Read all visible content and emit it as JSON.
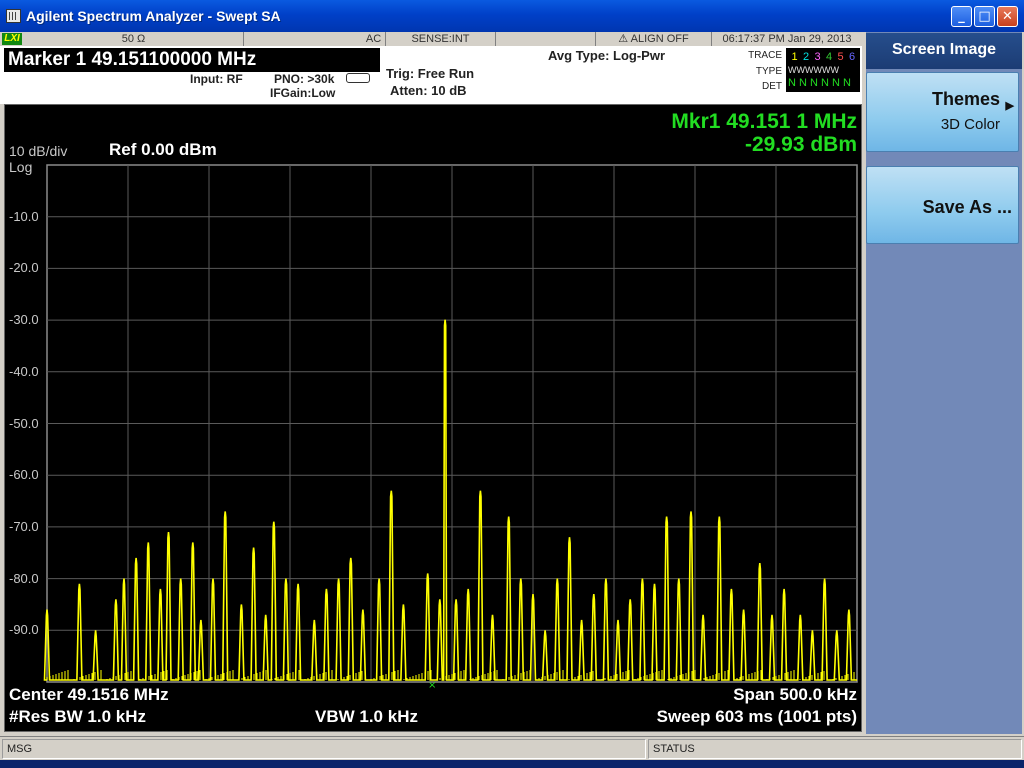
{
  "window": {
    "title": "Agilent Spectrum Analyzer - Swept SA",
    "minimize": "_",
    "maximize": "□",
    "close": "✕"
  },
  "status": {
    "lxi": "LXI",
    "impedance": "50 Ω",
    "coupling": "AC",
    "sense": "SENSE:INT",
    "align": "ALIGN OFF",
    "datetime": "06:17:37 PM Jan 29, 2013"
  },
  "marker_header": {
    "marker_title": "Marker 1  49.151100000 MHz",
    "input": "Input: RF",
    "pno": "PNO: >30k",
    "ifgain": "IFGain:Low",
    "trig": "Trig: Free Run",
    "atten": "Atten: 10 dB",
    "avg_type": "Avg Type: Log-Pwr",
    "trace_label": "TRACE",
    "type_label": "TYPE",
    "det_label": "DET",
    "trace_numbers": [
      "1",
      "2",
      "3",
      "4",
      "5",
      "6"
    ],
    "trace_colors": [
      "#ffff00",
      "#00e0e0",
      "#ff66ff",
      "#33cc33",
      "#ff5050",
      "#6666ff"
    ],
    "type_row": "WWWWWW",
    "det_row": "N N N N N N"
  },
  "display": {
    "scale": "10 dB/div",
    "scale_type": "Log",
    "ref_level": "Ref 0.00 dBm",
    "marker_readout_freq": "Mkr1 49.151 1 MHz",
    "marker_readout_amp": "-29.93 dBm",
    "marker_label": "1",
    "center": "Center 49.1516 MHz",
    "span": "Span 500.0 kHz",
    "rbw": "#Res BW 1.0 kHz",
    "vbw": "VBW 1.0 kHz",
    "sweep": "Sweep  603 ms (1001 pts)",
    "y_labels": [
      "-10.0",
      "-20.0",
      "-30.0",
      "-40.0",
      "-50.0",
      "-60.0",
      "-70.0",
      "-80.0",
      "-90.0"
    ]
  },
  "softkeys": {
    "header": "Screen Image",
    "themes_label": "Themes",
    "themes_value": "3D Color",
    "save_as": "Save As ..."
  },
  "msgbar": {
    "msg": "MSG",
    "status": "STATUS"
  },
  "chart_data": {
    "type": "line",
    "ref_level_dbm": 0,
    "db_per_div": 10,
    "ylim": [
      -100,
      0
    ],
    "center_mhz": 49.1516,
    "span_khz": 500,
    "marker": {
      "freq_mhz": 49.1511,
      "amp_dbm": -29.93
    },
    "trace_color": "#ffff00",
    "peaks": [
      {
        "pos": 0.0,
        "amp": -86
      },
      {
        "pos": 0.04,
        "amp": -81
      },
      {
        "pos": 0.06,
        "amp": -90
      },
      {
        "pos": 0.085,
        "amp": -84
      },
      {
        "pos": 0.095,
        "amp": -80
      },
      {
        "pos": 0.11,
        "amp": -76
      },
      {
        "pos": 0.125,
        "amp": -73
      },
      {
        "pos": 0.14,
        "amp": -82
      },
      {
        "pos": 0.15,
        "amp": -71
      },
      {
        "pos": 0.165,
        "amp": -80
      },
      {
        "pos": 0.18,
        "amp": -73
      },
      {
        "pos": 0.19,
        "amp": -88
      },
      {
        "pos": 0.205,
        "amp": -80
      },
      {
        "pos": 0.22,
        "amp": -67
      },
      {
        "pos": 0.24,
        "amp": -85
      },
      {
        "pos": 0.255,
        "amp": -74
      },
      {
        "pos": 0.27,
        "amp": -87
      },
      {
        "pos": 0.28,
        "amp": -69
      },
      {
        "pos": 0.295,
        "amp": -80
      },
      {
        "pos": 0.31,
        "amp": -81
      },
      {
        "pos": 0.33,
        "amp": -88
      },
      {
        "pos": 0.345,
        "amp": -82
      },
      {
        "pos": 0.36,
        "amp": -80
      },
      {
        "pos": 0.375,
        "amp": -76
      },
      {
        "pos": 0.39,
        "amp": -86
      },
      {
        "pos": 0.41,
        "amp": -80
      },
      {
        "pos": 0.425,
        "amp": -63
      },
      {
        "pos": 0.44,
        "amp": -85
      },
      {
        "pos": 0.4915,
        "amp": -29.93
      },
      {
        "pos": 0.47,
        "amp": -79
      },
      {
        "pos": 0.485,
        "amp": -84
      },
      {
        "pos": 0.505,
        "amp": -84
      },
      {
        "pos": 0.52,
        "amp": -82
      },
      {
        "pos": 0.535,
        "amp": -63
      },
      {
        "pos": 0.55,
        "amp": -87
      },
      {
        "pos": 0.57,
        "amp": -68
      },
      {
        "pos": 0.585,
        "amp": -80
      },
      {
        "pos": 0.6,
        "amp": -83
      },
      {
        "pos": 0.615,
        "amp": -90
      },
      {
        "pos": 0.63,
        "amp": -80
      },
      {
        "pos": 0.645,
        "amp": -72
      },
      {
        "pos": 0.66,
        "amp": -88
      },
      {
        "pos": 0.675,
        "amp": -83
      },
      {
        "pos": 0.69,
        "amp": -80
      },
      {
        "pos": 0.705,
        "amp": -88
      },
      {
        "pos": 0.72,
        "amp": -84
      },
      {
        "pos": 0.735,
        "amp": -80
      },
      {
        "pos": 0.75,
        "amp": -81
      },
      {
        "pos": 0.765,
        "amp": -68
      },
      {
        "pos": 0.78,
        "amp": -80
      },
      {
        "pos": 0.795,
        "amp": -67
      },
      {
        "pos": 0.81,
        "amp": -87
      },
      {
        "pos": 0.83,
        "amp": -68
      },
      {
        "pos": 0.845,
        "amp": -82
      },
      {
        "pos": 0.86,
        "amp": -86
      },
      {
        "pos": 0.88,
        "amp": -77
      },
      {
        "pos": 0.895,
        "amp": -87
      },
      {
        "pos": 0.91,
        "amp": -82
      },
      {
        "pos": 0.93,
        "amp": -87
      },
      {
        "pos": 0.945,
        "amp": -90
      },
      {
        "pos": 0.96,
        "amp": -80
      },
      {
        "pos": 0.975,
        "amp": -90
      },
      {
        "pos": 0.99,
        "amp": -86
      }
    ]
  }
}
